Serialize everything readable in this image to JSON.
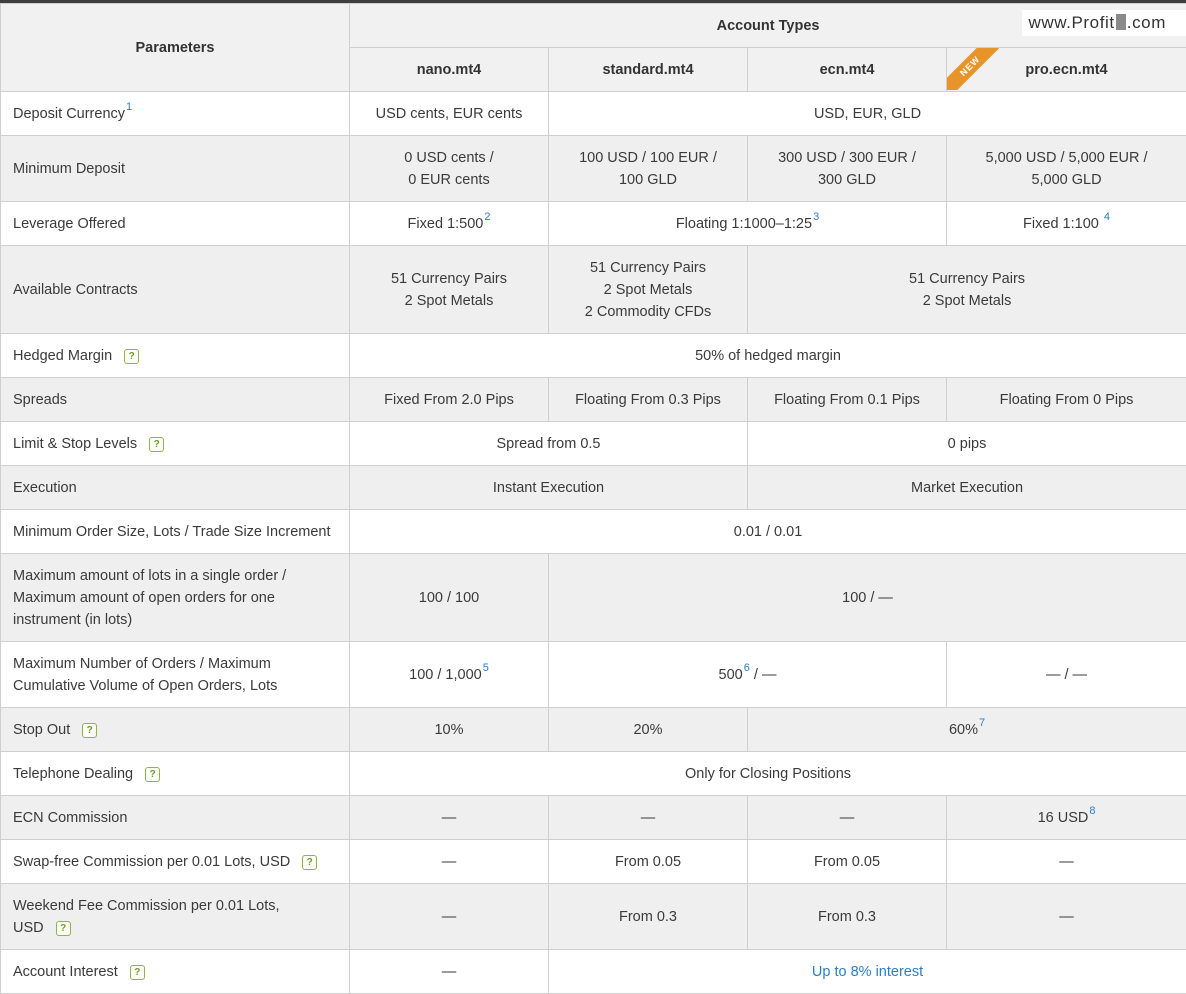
{
  "brand": {
    "prefix": "www.Profit",
    "suffix": ".com"
  },
  "header": {
    "params_label": "Parameters",
    "account_types_label": "Account Types",
    "columns": [
      "nano.mt4",
      "standard.mt4",
      "ecn.mt4",
      "pro.ecn.mt4"
    ],
    "new_badge": "NEW"
  },
  "rows": {
    "deposit_currency": {
      "label": "Deposit Currency",
      "fn": "1",
      "nano": "USD cents, EUR cents",
      "others": "USD, EUR, GLD"
    },
    "minimum_deposit": {
      "label": "Minimum Deposit",
      "nano_l1": "0 USD cents /",
      "nano_l2": "0 EUR cents",
      "std_l1": "100 USD / 100 EUR /",
      "std_l2": "100 GLD",
      "ecn_l1": "300 USD / 300 EUR /",
      "ecn_l2": "300 GLD",
      "pro_l1": "5,000 USD / 5,000 EUR /",
      "pro_l2": "5,000 GLD"
    },
    "leverage": {
      "label": "Leverage Offered",
      "nano": "Fixed 1:500",
      "nano_fn": "2",
      "mid": "Floating 1:1000–1:25",
      "mid_fn": "3",
      "pro": "Fixed 1:100",
      "pro_fn": "4"
    },
    "contracts": {
      "label": "Available Contracts",
      "nano_l1": "51 Currency Pairs",
      "nano_l2": "2 Spot Metals",
      "std_l1": "51 Currency Pairs",
      "std_l2": "2 Spot Metals",
      "std_l3": "2 Commodity CFDs",
      "rest_l1": "51 Currency Pairs",
      "rest_l2": "2 Spot Metals"
    },
    "hedged_margin": {
      "label": "Hedged Margin",
      "all": "50% of hedged margin"
    },
    "spreads": {
      "label": "Spreads",
      "nano": "Fixed From 2.0 Pips",
      "std": "Floating From 0.3 Pips",
      "ecn": "Floating From 0.1 Pips",
      "pro": "Floating From 0 Pips"
    },
    "limit_stop": {
      "label": "Limit & Stop Levels",
      "left": "Spread from 0.5",
      "right": "0 pips"
    },
    "execution": {
      "label": "Execution",
      "left": "Instant Execution",
      "right": "Market Execution"
    },
    "min_order": {
      "label": "Minimum Order Size, Lots / Trade Size Increment",
      "all": "0.01 / 0.01"
    },
    "max_lots": {
      "label_l1": "Maximum amount of lots in a single order /",
      "label_l2": "Maximum amount of open orders for one",
      "label_l3": "instrument (in lots)",
      "nano": "100 / 100",
      "rest": "100 / —"
    },
    "max_orders": {
      "label_l1": "Maximum Number of Orders / Maximum",
      "label_l2": "Cumulative Volume of Open Orders, Lots",
      "nano": "100 / 1,000",
      "nano_fn": "5",
      "mid_a": "500",
      "mid_fn": "6",
      "mid_b": " / —",
      "pro": "— / —"
    },
    "stop_out": {
      "label": "Stop Out",
      "nano": "10%",
      "std": "20%",
      "rest": "60%",
      "rest_fn": "7"
    },
    "telephone": {
      "label": "Telephone Dealing",
      "all": "Only for Closing Positions"
    },
    "ecn_commission": {
      "label": "ECN Commission",
      "nano": "—",
      "std": "—",
      "ecn": "—",
      "pro": "16 USD",
      "pro_fn": "8"
    },
    "swap_free": {
      "label": "Swap-free Commission per 0.01 Lots, USD",
      "nano": "—",
      "std": "From 0.05",
      "ecn": "From 0.05",
      "pro": "—"
    },
    "weekend_fee": {
      "label_l1": "Weekend Fee Commission per 0.01 Lots,",
      "label_l2": "USD",
      "nano": "—",
      "std": "From 0.3",
      "ecn": "From 0.3",
      "pro": "—"
    },
    "interest": {
      "label": "Account Interest",
      "nano": "—",
      "rest": "Up to 8% interest"
    }
  },
  "help_icon_glyph": "?",
  "colors": {
    "link": "#2a7fc4",
    "help": "#8fb34a",
    "badge": "#e7952a",
    "alt_row": "#efefef"
  }
}
